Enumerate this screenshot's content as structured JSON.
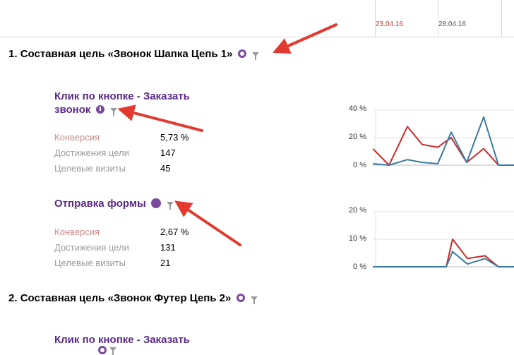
{
  "timeline": {
    "dates": [
      {
        "label": "23.04.16",
        "highlight": true
      },
      {
        "label": "28.04.16",
        "highlight": false
      }
    ]
  },
  "goals": [
    {
      "number": "1.",
      "title": "Составная цель «Звонок Шапка Цепь 1»",
      "steps": [
        {
          "title_line1": "Клик по кнопке - Заказать",
          "title_line2": "звонок",
          "badge_icon": "exclamation-badge-icon",
          "metrics": [
            {
              "label": "Конверсия",
              "value": "5,73 %"
            },
            {
              "label": "Достижения цели",
              "value": "147"
            },
            {
              "label": "Целевые визиты",
              "value": "45"
            }
          ]
        },
        {
          "title_line1": "Отправка формы",
          "badge_icon": "url-badge-icon",
          "metrics": [
            {
              "label": "Конверсия",
              "value": "2,67 %"
            },
            {
              "label": "Достижения цели",
              "value": "131"
            },
            {
              "label": "Целевые визиты",
              "value": "21"
            }
          ]
        }
      ]
    },
    {
      "number": "2.",
      "title": "Составная цель «Звонок Футер Цепь 2»",
      "steps": [
        {
          "title_line1": "Клик по кнопке - Заказать"
        }
      ]
    }
  ],
  "colors": {
    "red_series": "#cc2a2a",
    "blue_series": "#3a7aa0",
    "arrow": "#e23a2f",
    "goal_purple": "#5a2a86"
  },
  "chart_data": [
    {
      "type": "line",
      "ylim": [
        0,
        40
      ],
      "yticks": [
        "40 %",
        "20 %",
        "0 %"
      ],
      "series": [
        {
          "color": "#cc2a2a",
          "values": [
            12,
            0,
            28,
            15,
            13,
            20,
            2,
            12,
            0,
            0
          ]
        },
        {
          "color": "#3a7aa0",
          "values": [
            1,
            0,
            4,
            2,
            1,
            24,
            2,
            35,
            0,
            0
          ]
        }
      ]
    },
    {
      "type": "line",
      "ylim": [
        0,
        20
      ],
      "yticks": [
        "20 %",
        "10 %",
        "0 %"
      ],
      "series": [
        {
          "color": "#cc2a2a",
          "values": [
            0,
            0,
            0,
            0,
            0,
            0,
            0,
            10,
            3,
            4,
            0,
            0
          ]
        },
        {
          "color": "#3a7aa0",
          "values": [
            0,
            0,
            0,
            0,
            0,
            0,
            0,
            5.5,
            1,
            3,
            0,
            0
          ]
        }
      ]
    }
  ]
}
